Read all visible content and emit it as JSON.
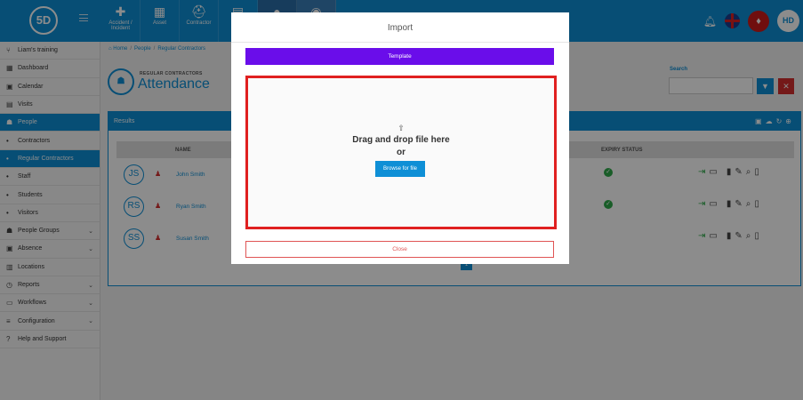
{
  "app": {
    "logo_text": "5D",
    "top_nav": [
      {
        "label": "Accident / Incident",
        "icon": "first-aid-icon"
      },
      {
        "label": "Asset",
        "icon": "boxes-icon"
      },
      {
        "label": "Contractor",
        "icon": "hard-hat-icon"
      },
      {
        "label": "",
        "icon": "document-icon"
      },
      {
        "label": "",
        "icon": "person-icon"
      },
      {
        "label": "",
        "icon": "database-icon"
      }
    ],
    "user_initials": "HD"
  },
  "sidebar": {
    "items": [
      {
        "label": "Liam's training",
        "icon": "branch-icon"
      },
      {
        "label": "Dashboard",
        "icon": "dashboard-icon"
      },
      {
        "label": "Calendar",
        "icon": "calendar-icon"
      },
      {
        "label": "Visits",
        "icon": "visits-icon"
      },
      {
        "label": "People",
        "icon": "people-icon"
      },
      {
        "label": "Contractors"
      },
      {
        "label": "Regular Contractors"
      },
      {
        "label": "Staff"
      },
      {
        "label": "Students"
      },
      {
        "label": "Visitors"
      },
      {
        "label": "People Groups",
        "icon": "groups-icon"
      },
      {
        "label": "Absence",
        "icon": "absence-icon"
      },
      {
        "label": "Locations",
        "icon": "locations-icon"
      },
      {
        "label": "Reports",
        "icon": "reports-icon"
      },
      {
        "label": "Workflows",
        "icon": "workflows-icon"
      },
      {
        "label": "Configuration",
        "icon": "configuration-icon"
      },
      {
        "label": "Help and Support",
        "icon": "help-icon"
      }
    ]
  },
  "breadcrumb": [
    "Home",
    "People",
    "Regular Contractors"
  ],
  "page": {
    "subtitle": "REGULAR CONTRACTORS",
    "title": "Attendance",
    "search_label": "Search"
  },
  "results": {
    "title": "Results",
    "columns": {
      "name": "NAME",
      "expiry": "EXPIRY STATUS"
    },
    "rows": [
      {
        "initials": "JS",
        "name": "John Smith"
      },
      {
        "initials": "RS",
        "name": "Ryan Smith"
      },
      {
        "initials": "SS",
        "name": "Susan Smith"
      }
    ],
    "current_page": "1"
  },
  "modal": {
    "title": "Import",
    "template_button": "Template",
    "dropzone_text": "Drag and drop file here",
    "dropzone_or": "or",
    "browse_button": "Browse for file",
    "close_button": "Close"
  },
  "colors": {
    "brand_blue": "#0e8fd6",
    "template_purple": "#6a0dea",
    "highlight_red": "#e02020",
    "danger_red": "#d32f2f",
    "success_green": "#2eaa4a"
  }
}
